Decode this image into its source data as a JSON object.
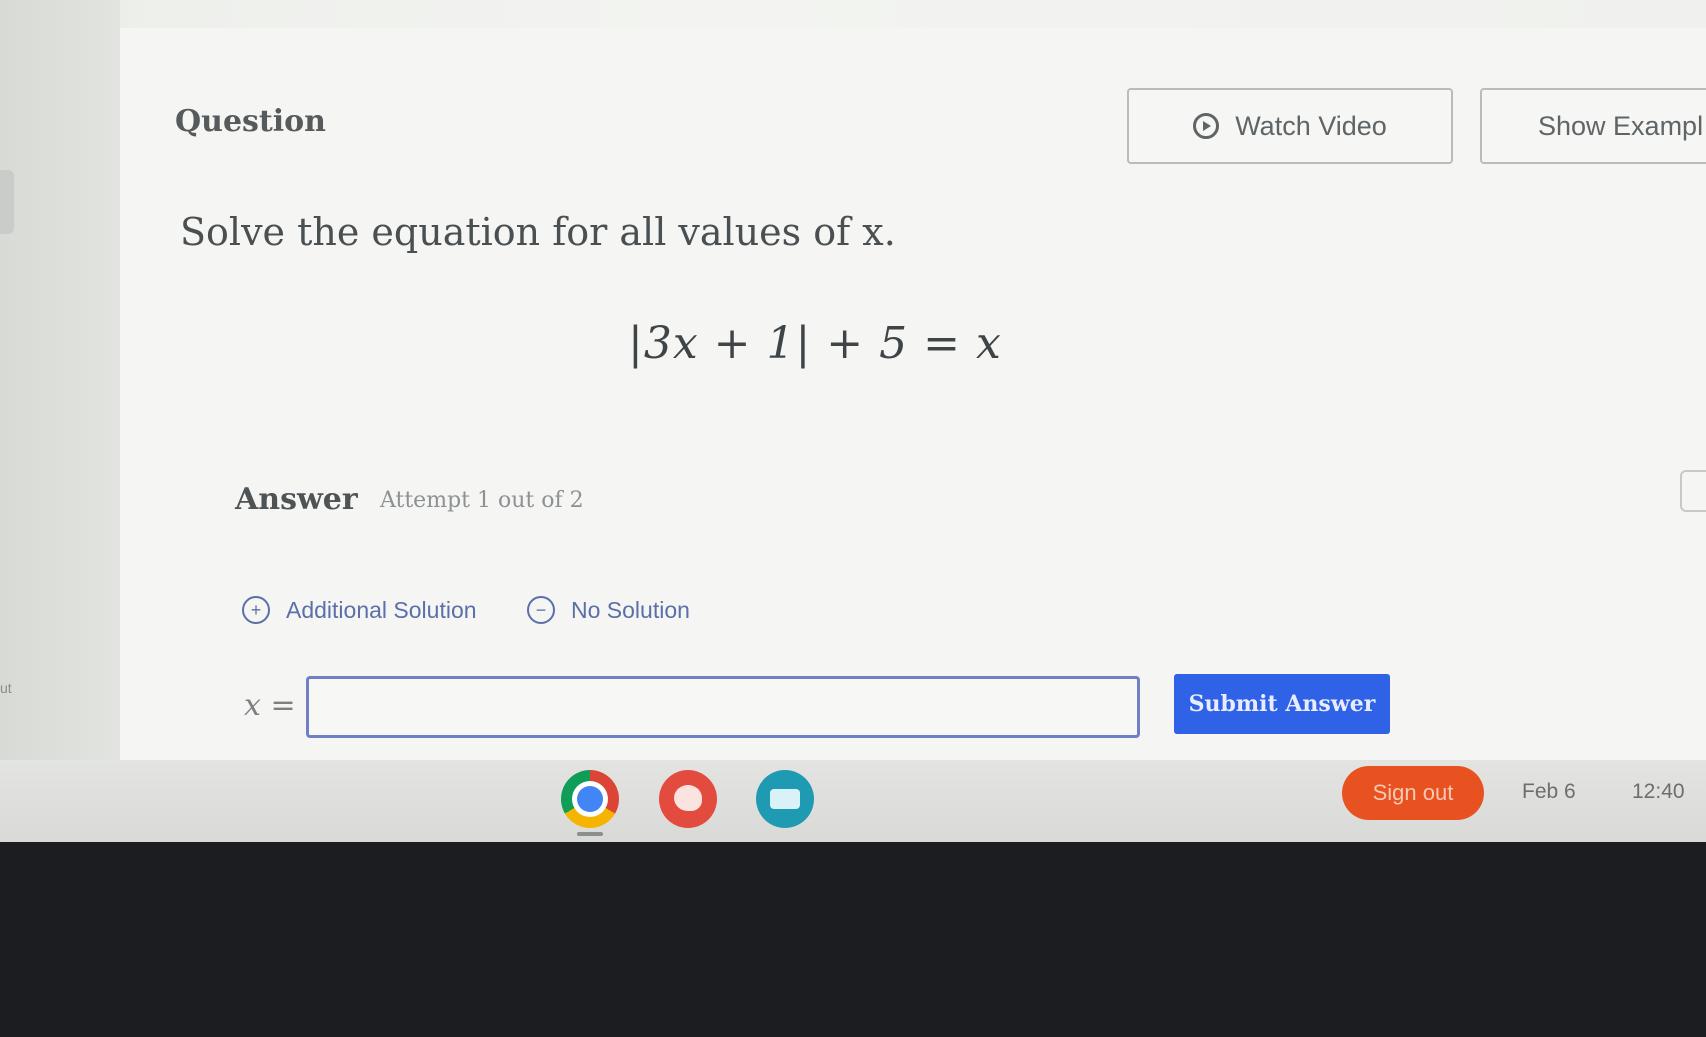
{
  "header": {
    "question_label": "Question",
    "watch_video_label": "Watch Video",
    "show_example_label": "Show Exampl"
  },
  "question": {
    "prompt": "Solve the equation for all values of x.",
    "equation": "|3x + 1| + 5 = x"
  },
  "answer": {
    "label": "Answer",
    "attempt": "Attempt 1 out of 2",
    "additional_solution_label": "Additional Solution",
    "no_solution_label": "No Solution",
    "variable_label": "x =",
    "input_value": "",
    "submit_label": "Submit Answer"
  },
  "left_edge": {
    "text": "ut"
  },
  "shelf": {
    "sign_out_label": "Sign out",
    "date": "Feb 6",
    "time": "12:40",
    "apps": [
      "chrome-icon",
      "palette-icon",
      "screencast-icon"
    ]
  },
  "colors": {
    "accent_blue": "#2f62e6",
    "link_blue": "#5b6fa8",
    "sign_out_orange": "#e85220"
  }
}
